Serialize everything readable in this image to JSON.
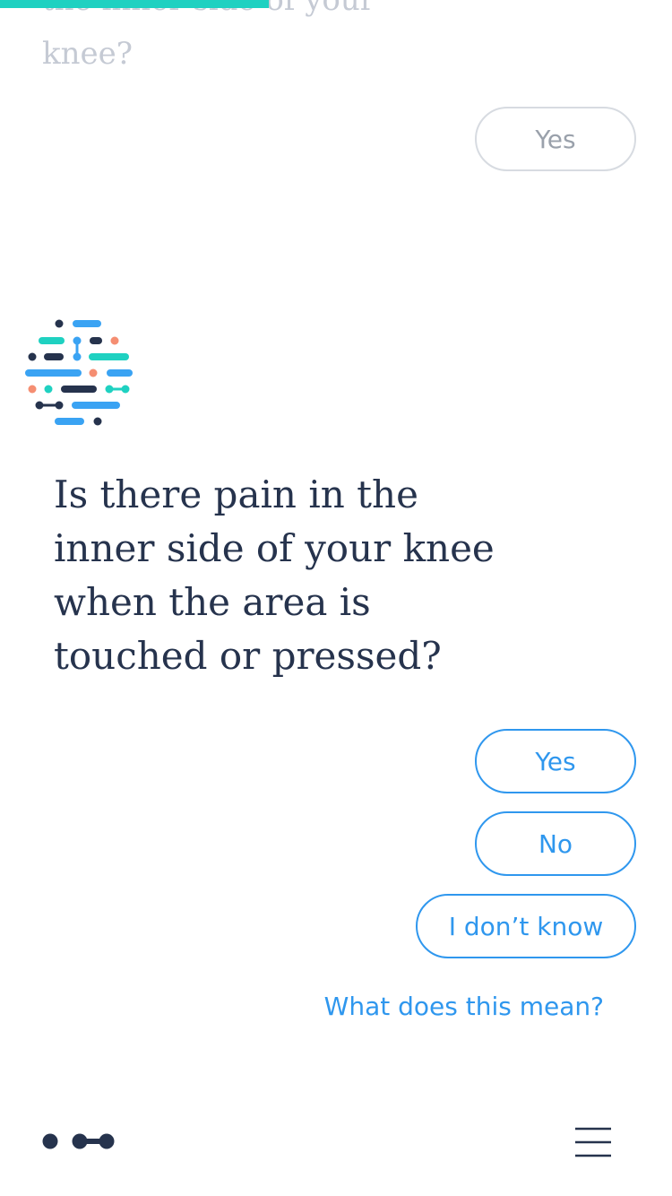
{
  "progress": {
    "fraction": 0.4,
    "color": "#1fd1c1"
  },
  "previous": {
    "question_fragment": "the inner side of your knee?",
    "answer_label": "Yes"
  },
  "current": {
    "question": "Is there pain in the inner side of your knee when the area is touched or pressed?",
    "options": {
      "yes": "Yes",
      "no": "No",
      "dont_know": "I don’t know"
    },
    "help_link": "What does this mean?"
  },
  "icons": {
    "avatar": "dot-pattern-logo-icon",
    "footer_logo": "brand-logo-icon",
    "menu": "hamburger-menu-icon"
  },
  "colors": {
    "accent": "#2f97ee",
    "teal": "#1fd1c1",
    "navy": "#26334d",
    "salmon": "#f58e72",
    "muted": "#9aa1ab"
  }
}
